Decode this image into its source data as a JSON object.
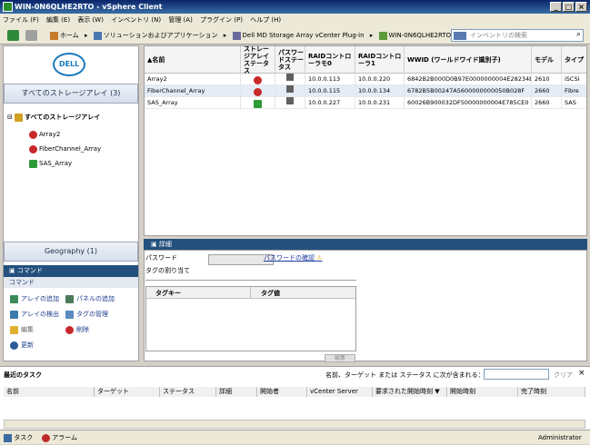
{
  "window": {
    "title": "WIN-0N6QLHE2RTO - vSphere Client",
    "minimize": "_",
    "maximize": "□",
    "close": "×"
  },
  "menu": [
    "ファイル (F)",
    "編集 (E)",
    "表示 (W)",
    "インベントリ (N)",
    "管理 (A)",
    "プラグイン (P)",
    "ヘルプ (H)"
  ],
  "breadcrumb": [
    "ホーム",
    "ソリューションおよびアプリケーション",
    "Dell MD Storage Array vCenter Plug-in",
    "WIN-0N6QLHE2RTO"
  ],
  "search": {
    "placeholder": "インベントリの検索"
  },
  "logo": "DELL",
  "left": {
    "all_arrays": "すべてのストレージアレイ (3)",
    "tree_root": "すべてのストレージアレイ",
    "tree_items": [
      "Array2",
      "FiberChannel_Array",
      "SAS_Array"
    ],
    "geography": "Geography (1)",
    "command_header": "コマンド",
    "command_sub": "コマンド",
    "commands": {
      "add_array": "アレイの追加",
      "add_panel": "パネルの追加",
      "detect_array": "アレイの検出",
      "manage_tags": "タグの管理",
      "edit": "編集",
      "delete": "削除",
      "refresh": "更新"
    }
  },
  "grid": {
    "headers": [
      "名前",
      "ストレージアレイステータス",
      "パスワードステータス",
      "RAIDコントローラモ0",
      "RAIDコントローラ1",
      "WWID (ワールドワイド識別子)",
      "モデル",
      "タイプ"
    ],
    "rows": [
      {
        "name": "Array2",
        "status": "error",
        "ip0": "10.0.0.113",
        "ip1": "10.0.0.220",
        "wwid": "6842B2B000D0B97E0000000004E28234E",
        "model": "2610",
        "type": "iSCSI"
      },
      {
        "name": "FiberChannel_Array",
        "status": "error",
        "ip0": "10.0.0.115",
        "ip1": "10.0.0.134",
        "wwid": "6782B5B00247A5600000000050B028F",
        "model": "2660",
        "type": "Fibre"
      },
      {
        "name": "SAS_Array",
        "status": "ok",
        "ip0": "10.0.0.227",
        "ip1": "10.0.0.231",
        "wwid": "60026B900032DF50000000004E785CE0",
        "model": "2660",
        "type": "SAS"
      }
    ]
  },
  "detail": {
    "header": "詳細",
    "password_label": "パスワード",
    "password_confirm": "パスワードの確認",
    "tag_assign": "タグの割り当て",
    "tag_key": "タグキー",
    "tag_value": "タグ値",
    "edit_btn": "編集"
  },
  "tasks": {
    "title": "最近のタスク",
    "filter_label": "名前、ターゲット または ステータス に次が含まれる：",
    "clear": "クリア",
    "close": "×",
    "columns": [
      "名前",
      "ターゲット",
      "ステータス",
      "詳細",
      "開始者",
      "vCenter Server",
      "要求された開始時刻",
      "開始時刻",
      "完了時刻"
    ]
  },
  "status": {
    "tasks": "タスク",
    "alarms": "アラーム",
    "user": "Administrator"
  }
}
